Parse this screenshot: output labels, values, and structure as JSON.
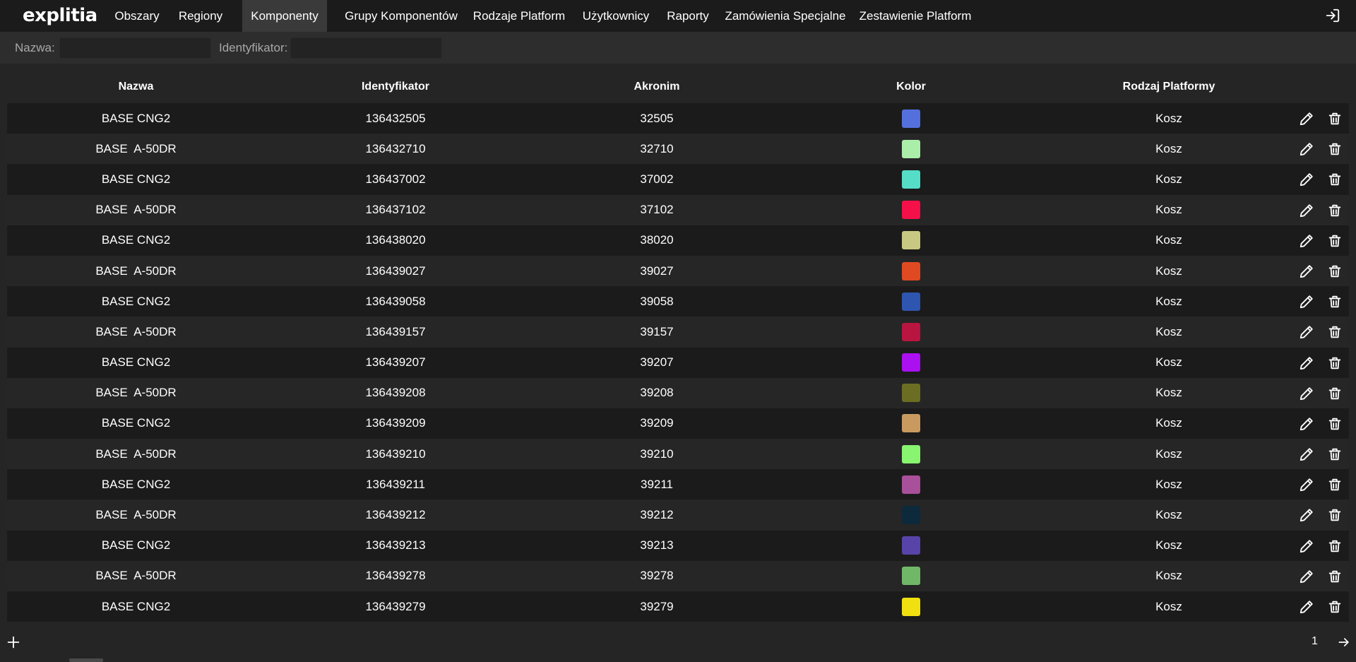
{
  "app": {
    "logo": "explitia"
  },
  "nav": {
    "items": [
      {
        "label": "Obszary"
      },
      {
        "label": "Regiony"
      },
      {
        "label": "Komponenty"
      },
      {
        "label": "Grupy Komponentów"
      },
      {
        "label": "Rodzaje Platform"
      },
      {
        "label": "Użytkownicy"
      },
      {
        "label": "Raporty"
      },
      {
        "label": "Zamówienia Specjalne"
      },
      {
        "label": "Zestawienie Platform"
      }
    ],
    "active": "Komponenty"
  },
  "filters": {
    "name_label": "Nazwa:",
    "name_value": "",
    "id_label": "Identyfikator:",
    "id_value": ""
  },
  "table": {
    "columns": [
      "Nazwa",
      "Identyfikator",
      "Akronim",
      "Kolor",
      "Rodzaj Platformy"
    ],
    "rows": [
      {
        "name": "BASE CNG2",
        "id": "136432505",
        "acronym": "32505",
        "color": "#5470dc",
        "platform": "Kosz"
      },
      {
        "name": "BASE  A-50DR",
        "id": "136432710",
        "acronym": "32710",
        "color": "#aaeeaa",
        "platform": "Kosz"
      },
      {
        "name": "BASE CNG2",
        "id": "136437002",
        "acronym": "37002",
        "color": "#55ddc8",
        "platform": "Kosz"
      },
      {
        "name": "BASE  A-50DR",
        "id": "136437102",
        "acronym": "37102",
        "color": "#f5104a",
        "platform": "Kosz"
      },
      {
        "name": "BASE CNG2",
        "id": "136438020",
        "acronym": "38020",
        "color": "#c8c882",
        "platform": "Kosz"
      },
      {
        "name": "BASE  A-50DR",
        "id": "136439027",
        "acronym": "39027",
        "color": "#e04a22",
        "platform": "Kosz"
      },
      {
        "name": "BASE CNG2",
        "id": "136439058",
        "acronym": "39058",
        "color": "#2e55b0",
        "platform": "Kosz"
      },
      {
        "name": "BASE  A-50DR",
        "id": "136439157",
        "acronym": "39157",
        "color": "#b81540",
        "platform": "Kosz"
      },
      {
        "name": "BASE CNG2",
        "id": "136439207",
        "acronym": "39207",
        "color": "#aa10f0",
        "platform": "Kosz"
      },
      {
        "name": "BASE  A-50DR",
        "id": "136439208",
        "acronym": "39208",
        "color": "#6b6e22",
        "platform": "Kosz"
      },
      {
        "name": "BASE CNG2",
        "id": "136439209",
        "acronym": "39209",
        "color": "#c89a60",
        "platform": "Kosz"
      },
      {
        "name": "BASE  A-50DR",
        "id": "136439210",
        "acronym": "39210",
        "color": "#88f470",
        "platform": "Kosz"
      },
      {
        "name": "BASE CNG2",
        "id": "136439211",
        "acronym": "39211",
        "color": "#a8509a",
        "platform": "Kosz"
      },
      {
        "name": "BASE  A-50DR",
        "id": "136439212",
        "acronym": "39212",
        "color": "#0c2a3c",
        "platform": "Kosz"
      },
      {
        "name": "BASE CNG2",
        "id": "136439213",
        "acronym": "39213",
        "color": "#5844a8",
        "platform": "Kosz"
      },
      {
        "name": "BASE  A-50DR",
        "id": "136439278",
        "acronym": "39278",
        "color": "#70b868",
        "platform": "Kosz"
      },
      {
        "name": "BASE CNG2",
        "id": "136439279",
        "acronym": "39279",
        "color": "#f0e010",
        "platform": "Kosz"
      }
    ]
  },
  "pagination": {
    "page": "1"
  },
  "icons": {
    "logout": "logout-icon",
    "edit": "pencil-icon",
    "delete": "trash-icon",
    "add": "plus-icon",
    "next": "arrow-right-icon"
  }
}
